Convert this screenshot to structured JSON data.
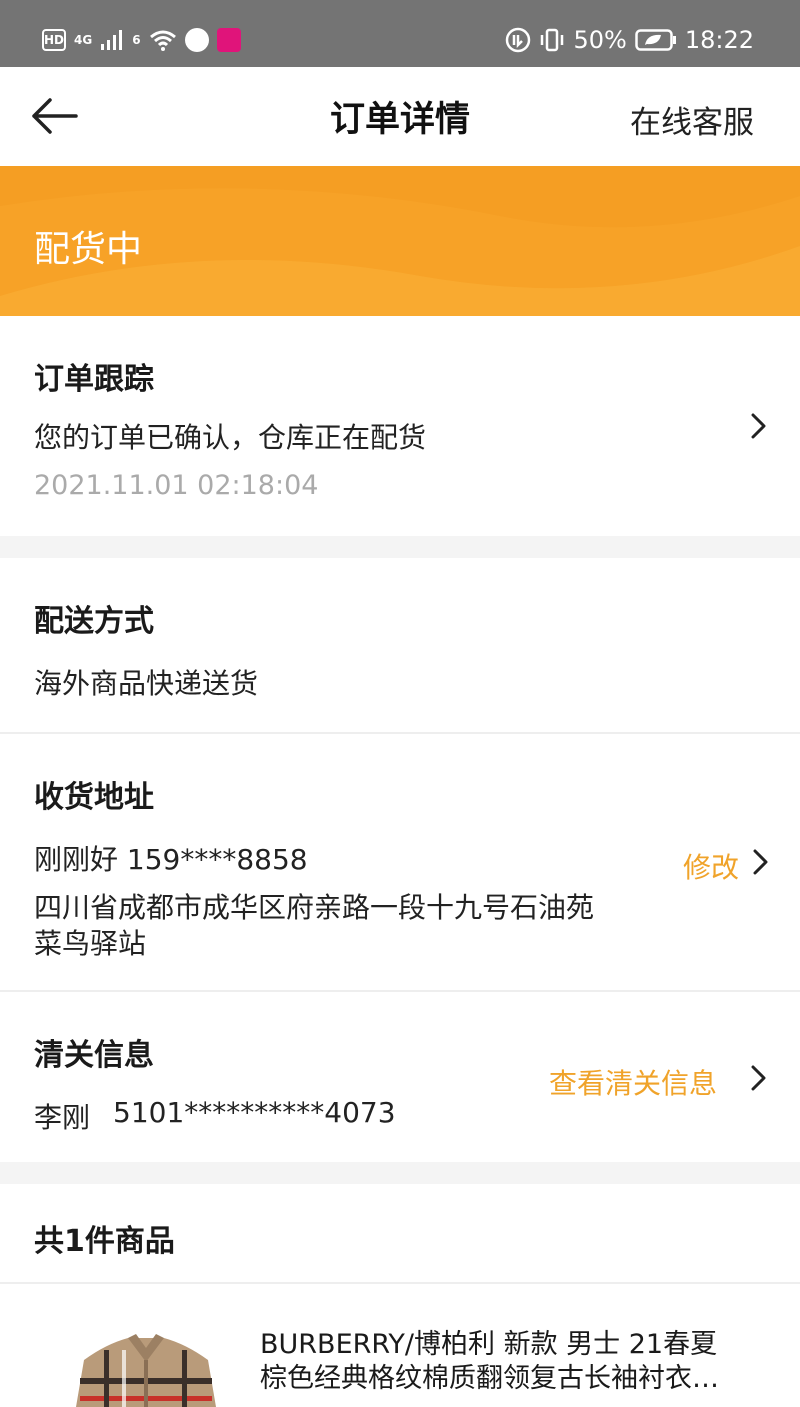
{
  "status_bar": {
    "left_icons": [
      "hd-badge-icon",
      "signal-4g-icon",
      "wifi-icon",
      "audio-icon",
      "app-notification-icon"
    ],
    "hd_label": "HD",
    "network_label": "4G",
    "wifi_label": "6",
    "battery_percent": "50%",
    "time": "18:22"
  },
  "header": {
    "title": "订单详情",
    "service_label": "在线客服"
  },
  "banner": {
    "status": "配货中",
    "color": "#f7a227"
  },
  "tracking": {
    "title": "订单跟踪",
    "message": "您的订单已确认，仓库正在配货",
    "time": "2021.11.01 02:18:04"
  },
  "delivery": {
    "title": "配送方式",
    "method": "海外商品快递送货"
  },
  "address": {
    "title": "收货地址",
    "contact": "刚刚好 159****8858",
    "line1": "四川省成都市成华区府亲路一段十九号石油苑",
    "line2": "菜鸟驿站",
    "edit_label": "修改"
  },
  "customs": {
    "title": "清关信息",
    "name": "李刚",
    "id_number": "5101**********4073",
    "view_label": "查看清关信息"
  },
  "products": {
    "summary": "共1件商品",
    "items": [
      {
        "name_line1": "BURBERRY/博柏利 新款  男士 21春夏",
        "name_line2": "棕色经典格纹棉质翻领复古长袖衬衣…"
      }
    ]
  },
  "colors": {
    "accent": "#f0a32a",
    "status_bar": "#747474"
  }
}
